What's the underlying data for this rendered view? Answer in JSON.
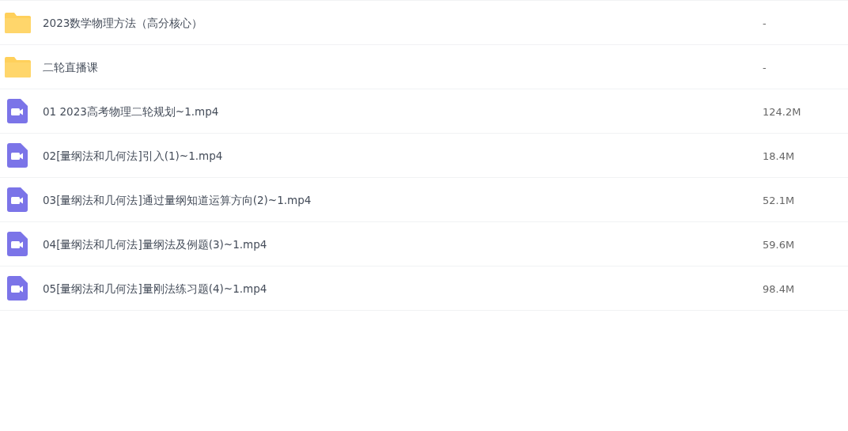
{
  "files": [
    {
      "kind": "folder",
      "name": "2023数学物理方法（高分核心）",
      "size": "-"
    },
    {
      "kind": "folder",
      "name": "二轮直播课",
      "size": "-"
    },
    {
      "kind": "video",
      "name": "01 2023高考物理二轮规划~1.mp4",
      "size": "124.2M"
    },
    {
      "kind": "video",
      "name": "02[量纲法和几何法]引入(1)~1.mp4",
      "size": "18.4M"
    },
    {
      "kind": "video",
      "name": "03[量纲法和几何法]通过量纲知道运算方向(2)~1.mp4",
      "size": "52.1M"
    },
    {
      "kind": "video",
      "name": "04[量纲法和几何法]量纲法及例题(3)~1.mp4",
      "size": "59.6M"
    },
    {
      "kind": "video",
      "name": "05[量纲法和几何法]量刚法练习题(4)~1.mp4",
      "size": "98.4M"
    }
  ]
}
